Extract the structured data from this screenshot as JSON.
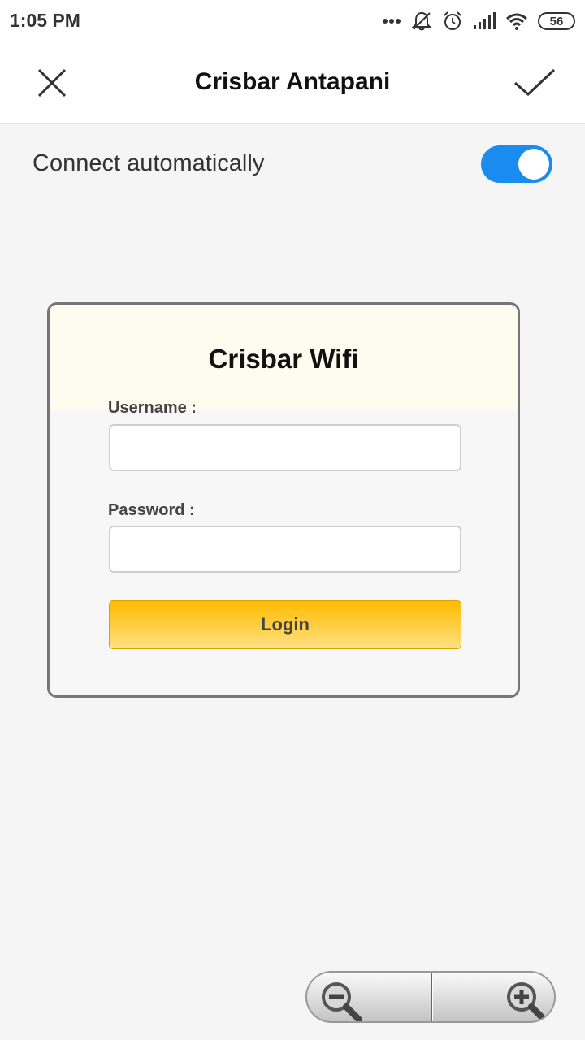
{
  "status_bar": {
    "time": "1:05 PM",
    "battery": "56",
    "icons": [
      "more-dots-icon",
      "bell-muted-icon",
      "alarm-icon",
      "signal-icon",
      "wifi-icon",
      "battery-icon"
    ]
  },
  "top_bar": {
    "title": "Crisbar Antapani",
    "close_icon": "close-icon",
    "confirm_icon": "checkmark-icon"
  },
  "settings": {
    "connect_automatically_label": "Connect automatically",
    "connect_automatically_on": true,
    "toggle_color": "#1a8cf0"
  },
  "login_form": {
    "title": "Crisbar Wifi",
    "username_label": "Username :",
    "username_value": "",
    "password_label": "Password :",
    "password_value": "",
    "login_button": "Login",
    "button_color_top": "#ffbb00",
    "button_color_bottom": "#ffe083"
  },
  "zoom": {
    "zoom_out_icon": "zoom-out-icon",
    "zoom_in_icon": "zoom-in-icon"
  }
}
